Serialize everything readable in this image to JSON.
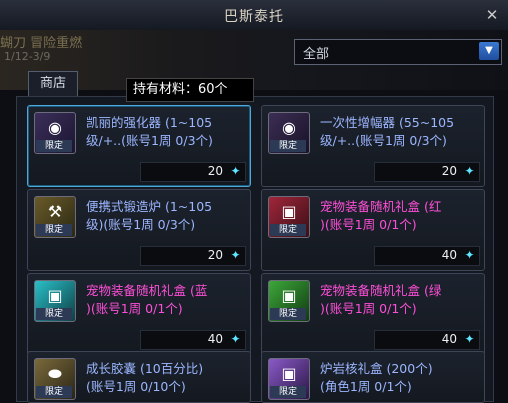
{
  "window": {
    "title": "巴斯泰托"
  },
  "background": {
    "text": "蝴刀 冒险重燃",
    "date": "1/12-3/9"
  },
  "tabs": [
    {
      "label": "商店"
    }
  ],
  "filter": {
    "selected": "全部"
  },
  "materials": {
    "label": "持有材料：60个"
  },
  "items": [
    {
      "name1": "凯丽的强化器 (1~105",
      "name2": "级/+..(账号1周 0/3个)",
      "color": "blue",
      "price": "20",
      "badge": "限定",
      "icon": "orb-icon"
    },
    {
      "name1": "一次性增幅器 (55~105",
      "name2": "级/+..(账号1周 0/3个)",
      "color": "blue",
      "price": "20",
      "badge": "限定",
      "icon": "orb-icon"
    },
    {
      "name1": "便携式锻造炉 (1~105",
      "name2": "级)(账号1周 0/3个)",
      "color": "blue",
      "price": "20",
      "badge": "限定",
      "icon": "forge-icon"
    },
    {
      "name1": "宠物装备随机礼盒 (红",
      "name2": ")(账号1周 0/1个)",
      "color": "pink",
      "price": "40",
      "badge": "限定",
      "icon": "gift-box-icon"
    },
    {
      "name1": "宠物装备随机礼盒 (蓝",
      "name2": ")(账号1周 0/1个)",
      "color": "pink",
      "price": "40",
      "badge": "限定",
      "icon": "gift-box-icon"
    },
    {
      "name1": "宠物装备随机礼盒 (绿",
      "name2": ")(账号1周 0/1个)",
      "color": "pink",
      "price": "40",
      "badge": "限定",
      "icon": "gift-box-icon"
    },
    {
      "name1": "成长胶囊 (10百分比)",
      "name2": "(账号1周 0/10个)",
      "color": "blue",
      "price": "",
      "badge": "限定",
      "icon": "capsule-icon"
    },
    {
      "name1": "炉岩核礼盒 (200个)",
      "name2": "(角色1周 0/1个)",
      "color": "blue",
      "price": "",
      "badge": "限定",
      "icon": "gift-box-icon"
    }
  ],
  "colors": {
    "accent": "#4fa8d8",
    "pink_name": "#ff4fd8",
    "blue_name": "#9cb6ff"
  }
}
